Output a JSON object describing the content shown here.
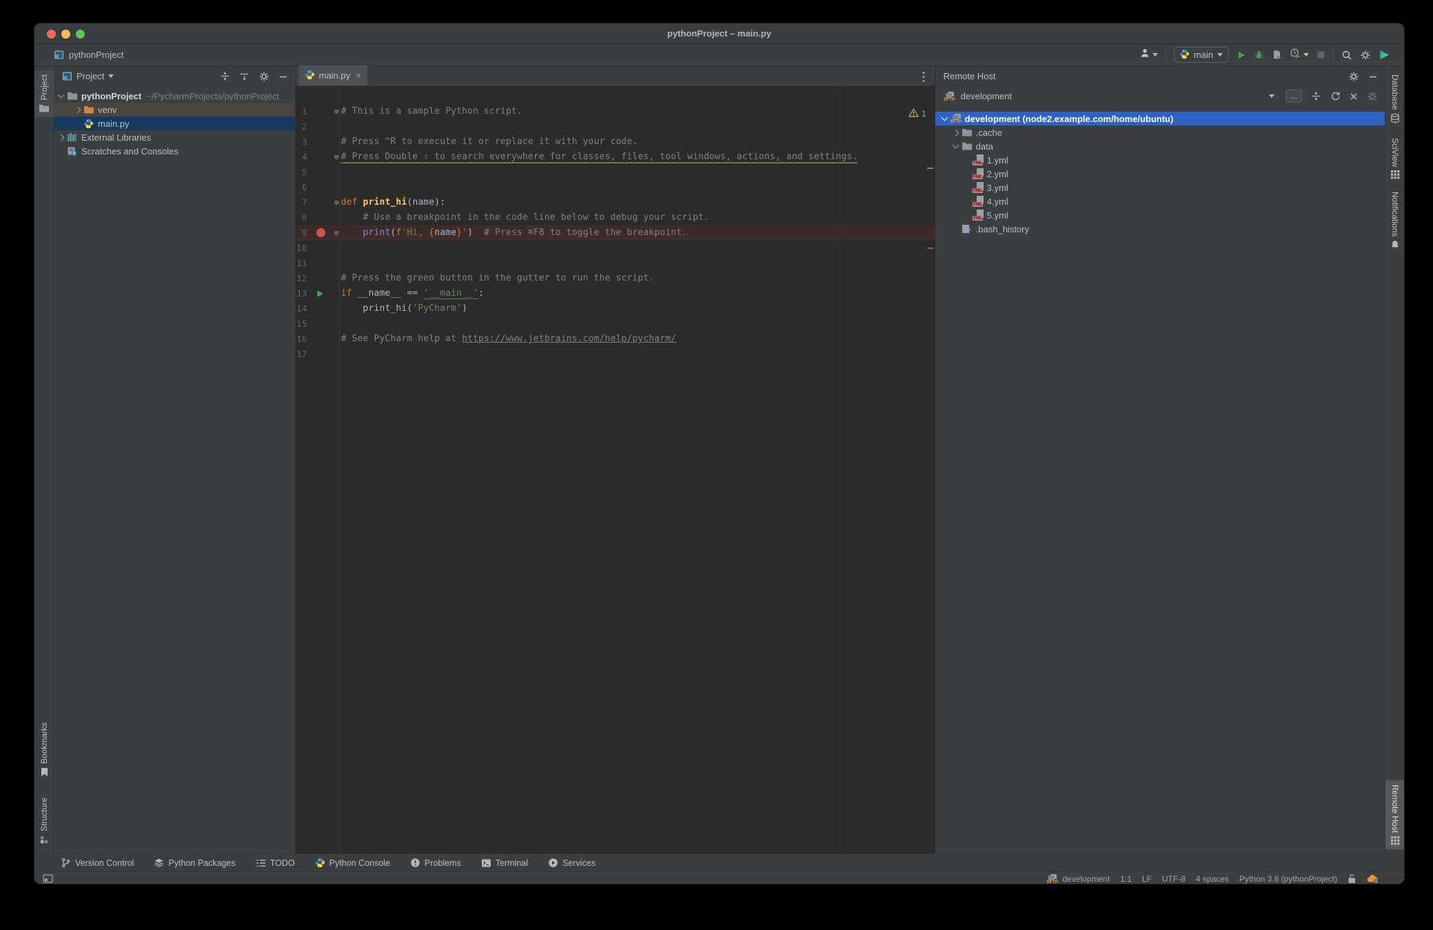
{
  "window": {
    "title": "pythonProject – main.py"
  },
  "toolbar": {
    "project": "pythonProject",
    "run_config": "main"
  },
  "left_strip": {
    "top": [
      {
        "label": "Project",
        "icon": "folder-tab",
        "active": true
      }
    ],
    "bottom": [
      {
        "label": "Bookmarks",
        "icon": "bookmark"
      },
      {
        "label": "Structure",
        "icon": "structure"
      }
    ]
  },
  "right_strip": {
    "top": [
      {
        "label": "Database",
        "icon": "database"
      },
      {
        "label": "SciView",
        "icon": "grid"
      },
      {
        "label": "Notifications",
        "icon": "bell"
      }
    ],
    "bottom": [
      {
        "label": "Remote Host",
        "icon": "grid",
        "active": true
      }
    ]
  },
  "project_panel": {
    "title": "Project",
    "tree": [
      {
        "label": "pythonProject",
        "hint": "~/PycharmProjects/pythonProject",
        "icon": "folder",
        "level": 0,
        "chevron": "down",
        "bold": true
      },
      {
        "label": "venv",
        "icon": "folder-excluded",
        "level": 1,
        "chevron": "right",
        "state": "hover-brown"
      },
      {
        "label": "main.py",
        "icon": "python",
        "level": 1,
        "state": "sel-dark"
      },
      {
        "label": "External Libraries",
        "icon": "libraries",
        "level": 0,
        "chevron": "right"
      },
      {
        "label": "Scratches and Consoles",
        "icon": "scratches",
        "level": 0
      }
    ]
  },
  "editor": {
    "tab": "main.py",
    "warning_count": "1",
    "lines": [
      {
        "fold": true,
        "tokens": [
          [
            "c",
            "# This is a sample Python script."
          ]
        ]
      },
      {
        "tokens": []
      },
      {
        "tokens": [
          [
            "c",
            "# Press ^R to execute it or replace it with your code."
          ]
        ]
      },
      {
        "fold": true,
        "tokens": [
          [
            "w",
            "# Press Double ⇧ to search everywhere for classes, files, tool windows, actions, and settings."
          ]
        ]
      },
      {
        "tokens": []
      },
      {
        "tokens": []
      },
      {
        "fold": true,
        "tokens": [
          [
            "k",
            "def "
          ],
          [
            "f",
            "print_hi"
          ],
          [
            "p",
            "(name):"
          ]
        ]
      },
      {
        "tokens": [
          [
            "p",
            "    "
          ],
          [
            "c",
            "# Use a breakpoint in the code line below to debug your script."
          ]
        ]
      },
      {
        "fold": true,
        "marker": "breakpoint",
        "highlight": true,
        "tokens": [
          [
            "p",
            "    "
          ],
          [
            "b",
            "print"
          ],
          [
            "p",
            "("
          ],
          [
            "k",
            "f"
          ],
          [
            "s",
            "'Hi, "
          ],
          [
            "k",
            "{"
          ],
          [
            "p",
            "name"
          ],
          [
            "k",
            "}"
          ],
          [
            "s",
            "'"
          ],
          [
            "p",
            ")"
          ],
          [
            "p",
            "  "
          ],
          [
            "c",
            "# Press ⌘F8 to toggle the breakpoint."
          ]
        ]
      },
      {
        "tokens": []
      },
      {
        "tokens": []
      },
      {
        "tokens": [
          [
            "c",
            "# Press the green button in the gutter to run the script."
          ]
        ]
      },
      {
        "marker": "run",
        "tokens": [
          [
            "k",
            "if "
          ],
          [
            "p",
            "__name__"
          ],
          [
            "p",
            " == "
          ],
          [
            "su",
            "'__main__'"
          ],
          [
            "p",
            ":"
          ]
        ]
      },
      {
        "tokens": [
          [
            "p",
            "    "
          ],
          [
            "p",
            "print_hi"
          ],
          [
            "p",
            "("
          ],
          [
            "s",
            "'PyCharm'"
          ],
          [
            "p",
            ")"
          ]
        ]
      },
      {
        "tokens": []
      },
      {
        "tokens": [
          [
            "c",
            "# See PyCharm help at "
          ],
          [
            "u",
            "https://www.jetbrains.com/help/pycharm/"
          ]
        ]
      },
      {
        "tokens": []
      }
    ]
  },
  "remote_panel": {
    "title": "Remote Host",
    "connection": "development",
    "more_label": "...",
    "tree": [
      {
        "label": "development (node2.example.com/home/ubuntu)",
        "icon": "sftp",
        "level": 0,
        "chevron": "down",
        "selected": true
      },
      {
        "label": ".cache",
        "icon": "folder",
        "level": 1,
        "chevron": "right"
      },
      {
        "label": "data",
        "icon": "folder",
        "level": 1,
        "chevron": "down"
      },
      {
        "label": "1.yml",
        "icon": "yml",
        "level": 2
      },
      {
        "label": "2.yml",
        "icon": "yml",
        "level": 2
      },
      {
        "label": "3.yml",
        "icon": "yml",
        "level": 2
      },
      {
        "label": "4.yml",
        "icon": "yml",
        "level": 2
      },
      {
        "label": "5.yml",
        "icon": "yml",
        "level": 2
      },
      {
        "label": ".bash_history",
        "icon": "file-unknown",
        "level": 1
      }
    ]
  },
  "bottom_bar": [
    {
      "label": "Version Control",
      "icon": "branch"
    },
    {
      "label": "Python Packages",
      "icon": "layers"
    },
    {
      "label": "TODO",
      "icon": "todo"
    },
    {
      "label": "Python Console",
      "icon": "python"
    },
    {
      "label": "Problems",
      "icon": "problems"
    },
    {
      "label": "Terminal",
      "icon": "terminal"
    },
    {
      "label": "Services",
      "icon": "services"
    }
  ],
  "status_bar": [
    {
      "icon": "sftp",
      "label": "development"
    },
    {
      "label": "1:1"
    },
    {
      "label": "LF"
    },
    {
      "label": "UTF-8"
    },
    {
      "label": "4 spaces"
    },
    {
      "label": "Python 3.8 (pythonProject)"
    },
    {
      "icon": "unlock"
    },
    {
      "icon": "cloud"
    }
  ],
  "colors": {
    "accent_selection": "#2d63c5",
    "editor_selection": "#163a5e",
    "breakpoint_line": "#3d2b2a",
    "breakpoint_dot": "#d25252",
    "run_green": "#499c54",
    "keyword": "#cc7832",
    "function": "#ffc66b",
    "string": "#6a8759",
    "comment": "#808080",
    "builtin": "#8888c6",
    "traffic": [
      "#ec6a5e",
      "#f5bf4f",
      "#61c554"
    ]
  }
}
